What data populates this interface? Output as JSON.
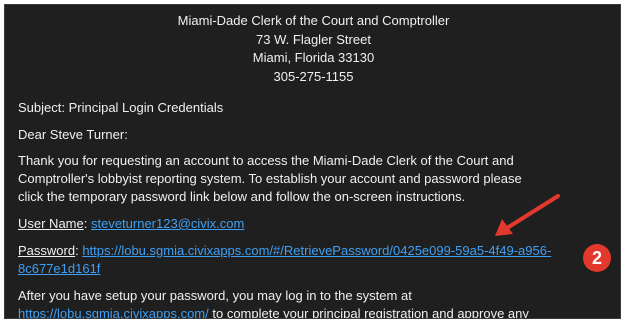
{
  "header": {
    "line1": "Miami-Dade Clerk of the Court and Comptroller",
    "line2": "73 W. Flagler Street",
    "line3": "Miami, Florida 33130",
    "line4": "305-275-1155"
  },
  "subject": "Subject: Principal Login Credentials",
  "greeting": "Dear Steve Turner:",
  "intro": {
    "line1": "Thank you for requesting an account to access the Miami-Dade Clerk of the Court and",
    "line2": "Comptroller's lobbyist reporting system. To establish your account and password please",
    "line3": "click the temporary password link below and follow the on-screen instructions."
  },
  "username": {
    "label": "User Name",
    "sep": ": ",
    "value": "steveturner123@civix.com"
  },
  "password": {
    "label": "Password",
    "sep": ": ",
    "link_line1": "https://lobu.sgmia.civixapps.com/#/RetrievePassword/0425e099-59a5-4f49-a956-",
    "link_line2": "8c677e1d161f"
  },
  "setup": {
    "line1": "After you have setup your password, you may log in to the system at",
    "link": "https://lobu.sgmia.civixapps.com/",
    "line2_rest": " to complete your principal registration and approve any"
  },
  "annotation": {
    "step_number": "2",
    "color": "#e2392c"
  },
  "colors": {
    "background": "#1f1f1f",
    "text": "#f0f0f0",
    "link": "#3fa0f5"
  }
}
